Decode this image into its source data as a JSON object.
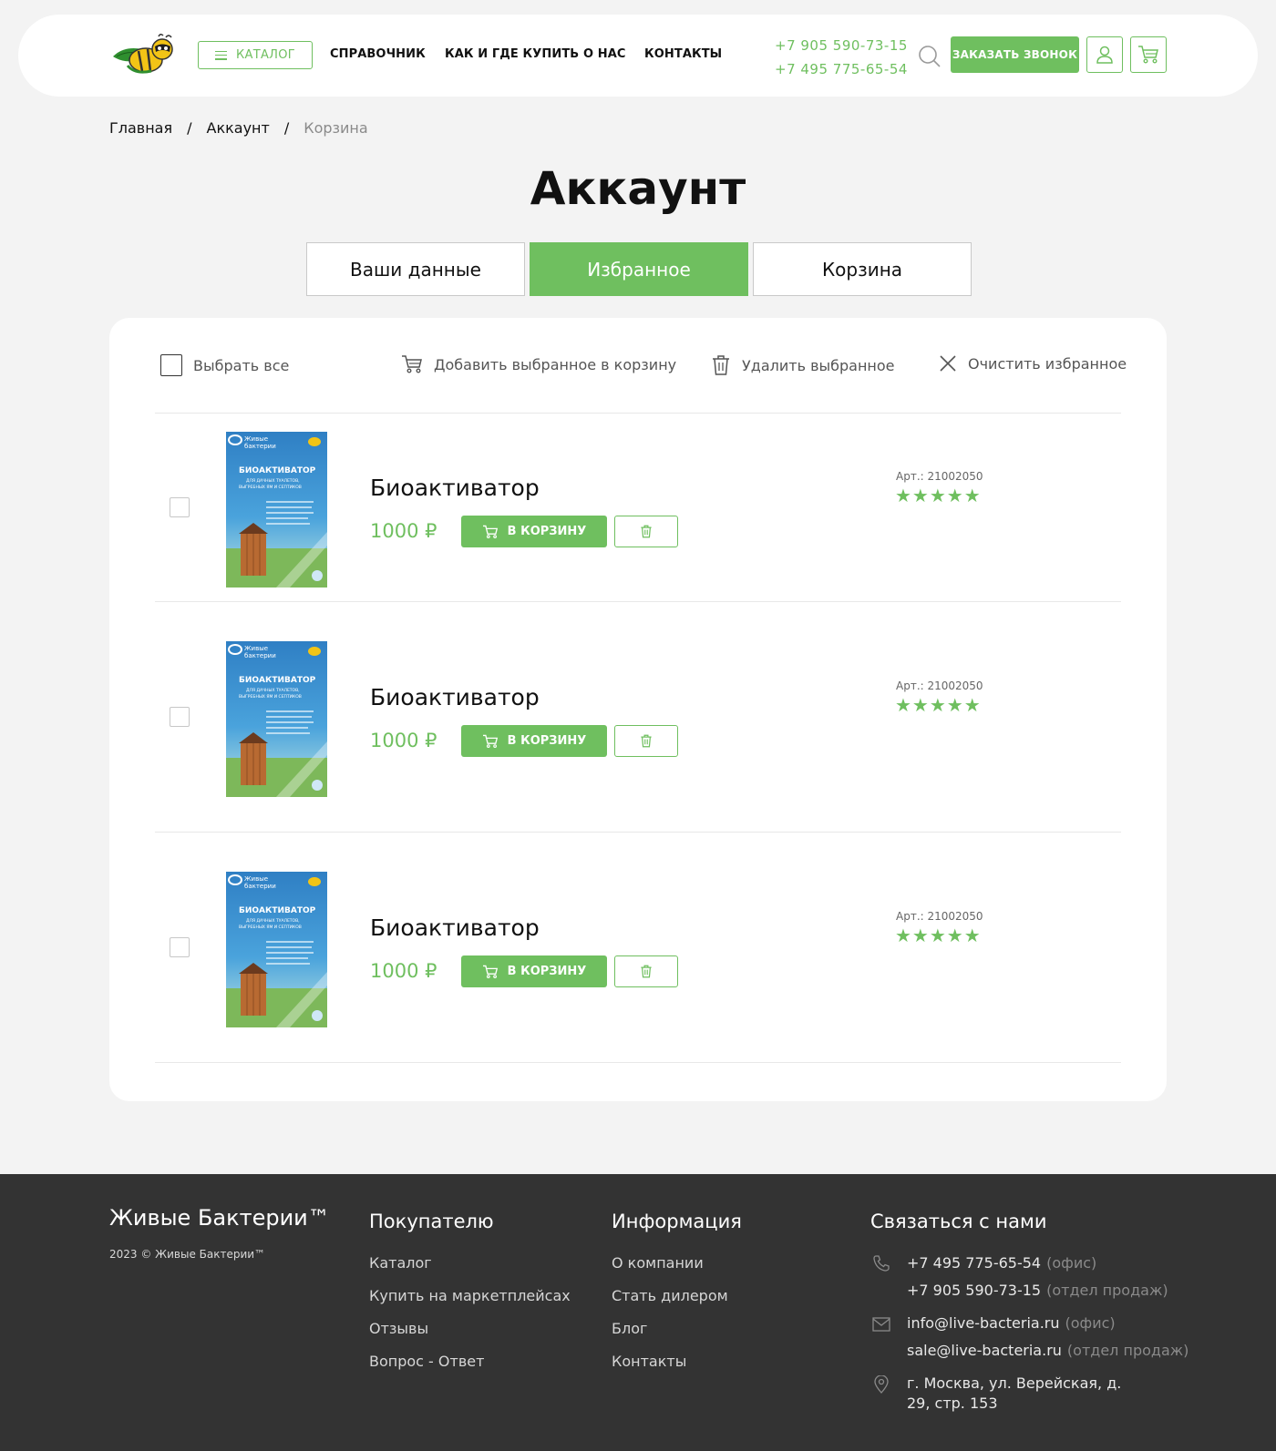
{
  "header": {
    "catalog_label": "КАТАЛОГ",
    "nav": [
      "СПРАВОЧНИК",
      "КАК И ГДЕ КУПИТЬ",
      "О НАС",
      "КОНТАКТЫ"
    ],
    "phone_1": "+7 905 590-73-15",
    "phone_2": "+7 495 775-65-54",
    "call_label": "ЗАКАЗАТЬ ЗВОНОК"
  },
  "breadcrumb": {
    "home": "Главная",
    "sep": "/",
    "account": "Аккаунт",
    "current": "Корзина"
  },
  "page_title": "Аккаунт",
  "tabs": [
    {
      "label": "Ваши данные"
    },
    {
      "label": "Избранное"
    },
    {
      "label": "Корзина"
    }
  ],
  "toolbar": {
    "select_all": "Выбрать все",
    "add_selected": "Добавить выбранное в корзину",
    "delete_selected": "Удалить выбранное",
    "clear_favorites": "Очистить избранное"
  },
  "products": [
    {
      "name": "Биоактиватор",
      "price": "1000 ₽",
      "cart_label": "В КОРЗИНУ",
      "art": "Арт.: 21002050",
      "rating": 5
    },
    {
      "name": "Биоактиватор",
      "price": "1000 ₽",
      "cart_label": "В КОРЗИНУ",
      "art": "Арт.: 21002050",
      "rating": 5
    },
    {
      "name": "Биоактиватор",
      "price": "1000 ₽",
      "cart_label": "В КОРЗИНУ",
      "art": "Арт.: 21002050",
      "rating": 5
    }
  ],
  "product_image": {
    "brand_1": "Живые",
    "brand_2": "бактерии",
    "title": "БИОАКТИВАТОР",
    "subtitle_1": "ДЛЯ ДАЧНЫХ ТУАЛЕТОВ,",
    "subtitle_2": "ВЫГРЕБНЫХ ЯМ И СЕПТИКОВ"
  },
  "footer": {
    "brand": "Живые Бактерии™",
    "copyright": "2023 © Живые Бактерии™",
    "buyer_title": "Покупателю",
    "buyer_links": [
      "Каталог",
      "Купить на маркетплейсах",
      "Отзывы",
      "Вопрос - Ответ"
    ],
    "info_title": "Информация",
    "info_links": [
      "О компании",
      "Стать дилером",
      "Блог",
      "Контакты"
    ],
    "contact_title": "Связаться с нами",
    "phone_office": "+7 495 775-65-54",
    "phone_office_note": "(офис)",
    "phone_sales": "+7 905 590-73-15",
    "phone_sales_note": "(отдел продаж)",
    "email_office": "info@live-bacteria.ru",
    "email_office_note": "(офис)",
    "email_sales": "sale@live-bacteria.ru",
    "email_sales_note": "(отдел продаж)",
    "address_1": "г. Москва, ул. Верейская, д.",
    "address_2": "29, стр. 153"
  },
  "colors": {
    "accent": "#6fbf5f",
    "footer_bg": "#333333",
    "page_bg": "#f3f3f3"
  }
}
